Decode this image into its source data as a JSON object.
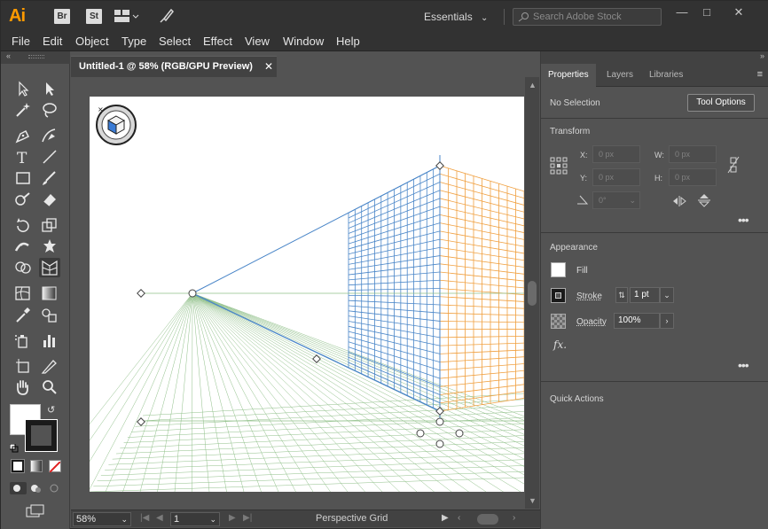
{
  "app": {
    "logo": "Ai",
    "bridge_label": "Br",
    "stock_label": "St",
    "workspace_label": "Essentials",
    "stock_search_placeholder": "Search Adobe Stock"
  },
  "menu": [
    "File",
    "Edit",
    "Object",
    "Type",
    "Select",
    "Effect",
    "View",
    "Window",
    "Help"
  ],
  "document": {
    "tab_title": "Untitled-1 @ 58% (RGB/GPU Preview)"
  },
  "status_bar": {
    "zoom": "58%",
    "page": "1",
    "active_tool": "Perspective Grid"
  },
  "panel": {
    "tabs": [
      "Properties",
      "Layers",
      "Libraries"
    ],
    "active_tab": "Properties",
    "selection_status": "No Selection",
    "tool_options_label": "Tool Options",
    "transform": {
      "title": "Transform",
      "x_label": "X:",
      "x_value": "0 px",
      "y_label": "Y:",
      "y_value": "0 px",
      "w_label": "W:",
      "w_value": "0 px",
      "h_label": "H:",
      "h_value": "0 px",
      "rotate_value": "0°"
    },
    "appearance": {
      "title": "Appearance",
      "fill_label": "Fill",
      "stroke_label": "Stroke",
      "stroke_weight": "1 pt",
      "opacity_label": "Opacity",
      "opacity_value": "100%",
      "fx_label": "fx."
    },
    "quick_actions_title": "Quick Actions"
  },
  "colors": {
    "accent_brand": "#ff9a00",
    "grid_left": "#4a86c8",
    "grid_right": "#f0a040",
    "grid_ground": "#8fbf88"
  }
}
